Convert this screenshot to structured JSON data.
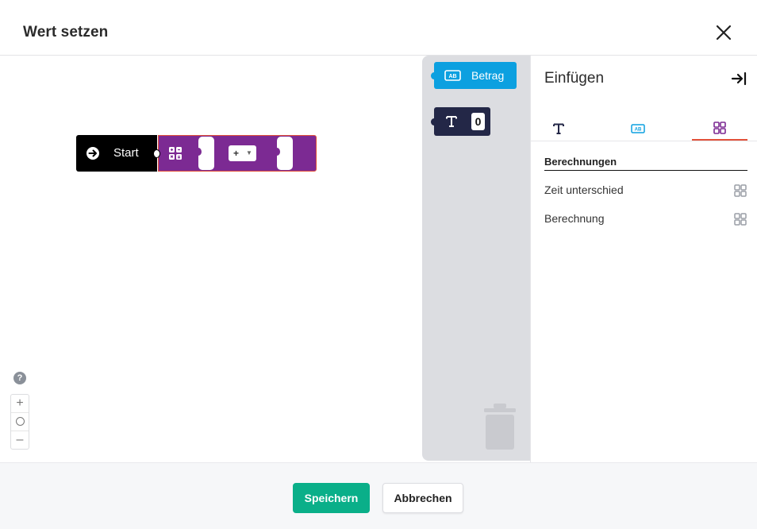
{
  "dialog": {
    "title": "Wert setzen"
  },
  "workspace": {
    "start_block": {
      "label": "Start",
      "color": "#000000"
    },
    "calc_block": {
      "operator": "+",
      "color": "#7c2a93",
      "outline": "#e2513a"
    },
    "help_icon": "?",
    "zoom": {
      "in": "+",
      "out": "–"
    }
  },
  "flyout": {
    "field_block": {
      "label": "Betrag",
      "color": "#0ca0e0"
    },
    "text_block": {
      "value": "0",
      "color": "#232747"
    }
  },
  "panel": {
    "title": "Einfügen",
    "tabs": [
      {
        "icon": "text-t-icon",
        "active": false
      },
      {
        "icon": "field-ab-icon",
        "active": false
      },
      {
        "icon": "calculation-grid-icon",
        "active": true
      }
    ],
    "section_title": "Berechnungen",
    "items": [
      {
        "label": "Zeit unterschied",
        "icon": "calculation-grid-icon"
      },
      {
        "label": "Berechnung",
        "icon": "calculation-grid-icon"
      }
    ]
  },
  "footer": {
    "save_label": "Speichern",
    "cancel_label": "Abbrechen",
    "save_color": "#0aaf89"
  }
}
